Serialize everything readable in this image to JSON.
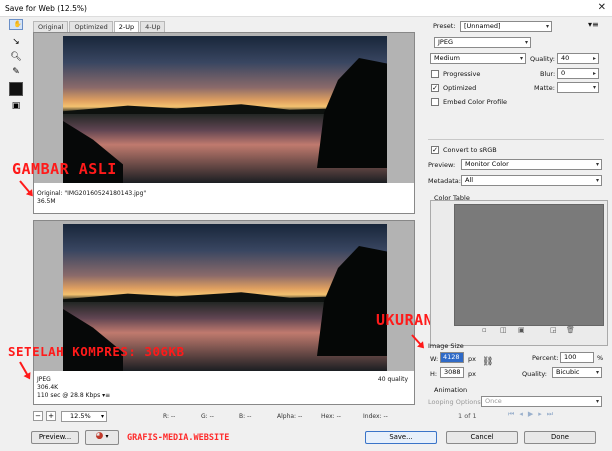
{
  "window": {
    "title": "Save for Web (12.5%)",
    "close": "✕"
  },
  "tabs": [
    "Original",
    "Optimized",
    "2-Up",
    "4-Up"
  ],
  "active_tab": "2-Up",
  "pane_original": {
    "line1": "Original: \"IMG20160524180143.jpg\"",
    "line2": "36.5M"
  },
  "pane_optimized": {
    "format": "JPEG",
    "size": "306.4K",
    "time": "110 sec @ 28.8 Kbps",
    "time_icon": "▾≡",
    "quality": "40 quality"
  },
  "annotations": {
    "gambar_asli": "GAMBAR ASLI",
    "setelah": "SETELAH KOMPRES: 306KB",
    "ukuran_asli": "UKURAN ASLI",
    "website": "GRAFIS-MEDIA.WEBSITE"
  },
  "bottom_bar": {
    "minus": "−",
    "plus": "+",
    "zoom": "12.5%",
    "r": "R: --",
    "g": "G: --",
    "b": "B: --",
    "alpha": "Alpha: --",
    "hex": "Hex: --",
    "index": "Index: --"
  },
  "bottom_buttons": {
    "preview": "Preview...",
    "save": "Save...",
    "cancel": "Cancel",
    "done": "Done"
  },
  "settings": {
    "preset_label": "Preset:",
    "preset_value": "[Unnamed]",
    "format": "JPEG",
    "compression": "Medium",
    "quality_label": "Quality:",
    "quality_value": "40",
    "progressive_label": "Progressive",
    "blur_label": "Blur:",
    "blur_value": "0",
    "optimized_label": "Optimized",
    "matte_label": "Matte:",
    "embed_label": "Embed Color Profile",
    "convert_label": "Convert to sRGB",
    "preview_label": "Preview:",
    "preview_value": "Monitor Color",
    "metadata_label": "Metadata:",
    "metadata_value": "All",
    "color_table_label": "Color Table",
    "image_size_label": "Image Size",
    "w_label": "W:",
    "w_value": "4128",
    "h_label": "H:",
    "h_value": "3088",
    "px": "px",
    "percent_label": "Percent:",
    "percent_value": "100",
    "percent_unit": "%",
    "quality2_label": "Quality:",
    "quality2_value": "Bicubic",
    "animation_label": "Animation",
    "looping_label": "Looping Options:",
    "looping_value": "Once",
    "frame_counter": "1 of 1"
  }
}
